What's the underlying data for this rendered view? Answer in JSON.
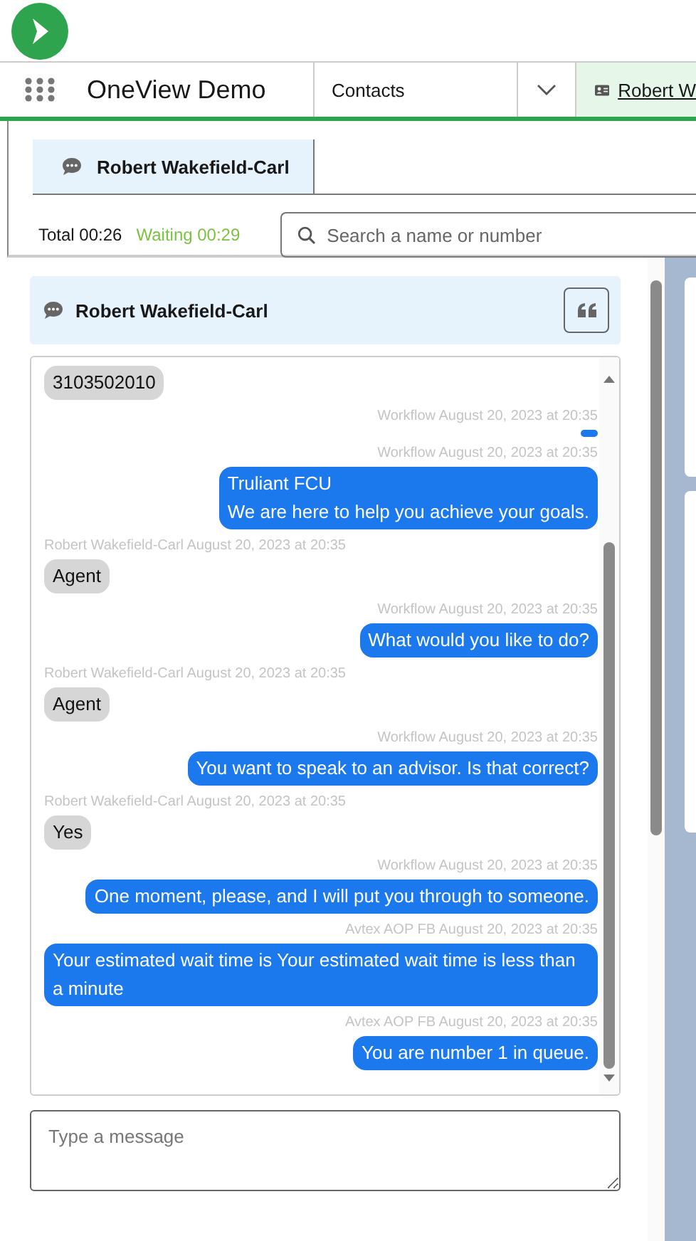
{
  "app_title": "OneView Demo",
  "nav_tabs": [
    {
      "label": "Contacts",
      "kind": "object",
      "selected": false
    },
    {
      "label": "Robert W",
      "kind": "record",
      "selected": true
    }
  ],
  "conversation_tab": {
    "label": "Robert Wakefield-Carl",
    "selected": true
  },
  "timers": {
    "total": "Total 00:26",
    "waiting": "Waiting 00:29"
  },
  "search": {
    "placeholder": "Search a name or number"
  },
  "chat": {
    "title": "Robert Wakefield-Carl",
    "messages": [
      {
        "kind": "incoming",
        "text": "3103502010"
      },
      {
        "kind": "outgoing",
        "meta": "Workflow August 20, 2023 at 20:35"
      },
      {
        "kind": "outgoing",
        "meta": "Workflow August 20, 2023 at 20:35",
        "lines": [
          "Truliant FCU",
          "We are here to help you achieve your goals."
        ]
      },
      {
        "kind": "incoming",
        "meta": "Robert Wakefield-Carl August 20, 2023 at 20:35",
        "text": "Agent"
      },
      {
        "kind": "outgoing",
        "meta": "Workflow August 20, 2023 at 20:35",
        "text": "What would you like to do?"
      },
      {
        "kind": "incoming",
        "meta": "Robert Wakefield-Carl August 20, 2023 at 20:35",
        "text": "Agent"
      },
      {
        "kind": "outgoing",
        "meta": "Workflow August 20, 2023 at 20:35",
        "text": "You want to speak to an advisor. Is that correct?"
      },
      {
        "kind": "incoming",
        "meta": "Robert Wakefield-Carl August 20, 2023 at 20:35",
        "text": "Yes"
      },
      {
        "kind": "outgoing",
        "meta": "Workflow August 20, 2023 at 20:35",
        "text": "One moment, please, and I will put you through to someone."
      },
      {
        "kind": "outgoing",
        "meta": "Avtex AOP FB August 20, 2023 at 20:35",
        "text": "Your estimated wait time is Your estimated wait time is less than a minute"
      },
      {
        "kind": "outgoing",
        "meta": "Avtex AOP FB August 20, 2023 at 20:35",
        "text": "You are number 1 in queue."
      }
    ]
  },
  "composer": {
    "placeholder": "Type a message"
  }
}
